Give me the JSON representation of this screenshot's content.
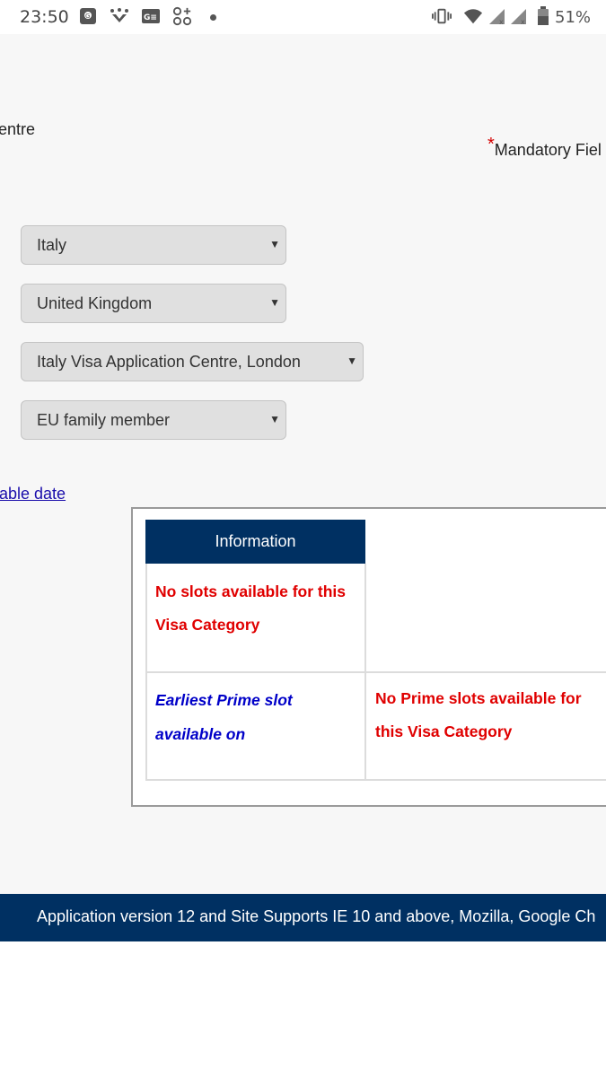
{
  "status_bar": {
    "time": "23:50",
    "battery": "51%",
    "icons": [
      "maps-icon",
      "spark-icon",
      "news-icon",
      "apps-icon",
      "vibrate-icon",
      "wifi-icon",
      "signal-icon",
      "signal-icon-2",
      "battery-icon"
    ]
  },
  "page": {
    "centre_fragment": "entre",
    "mandatory_label": "Mandatory Fiel",
    "mandatory_star": "*",
    "selects": {
      "country": "Italy",
      "residence": "United Kingdom",
      "centre": "Italy Visa Application Centre, London",
      "category": "EU family member"
    },
    "earliest_date_link": "able date"
  },
  "info_panel": {
    "header": "Information",
    "no_slots": "No slots available for this Visa Category",
    "prime_label": "Earliest Prime slot available on",
    "no_prime_slots": "No Prime slots available for this Visa Category"
  },
  "footer": {
    "text": "Application version 12 and Site Supports IE 10 and above, Mozilla, Google Ch"
  },
  "colors": {
    "brand_navy": "#003062",
    "error_red": "#e00000",
    "info_blue": "#0000c8",
    "select_bg": "#e0e0e0"
  }
}
